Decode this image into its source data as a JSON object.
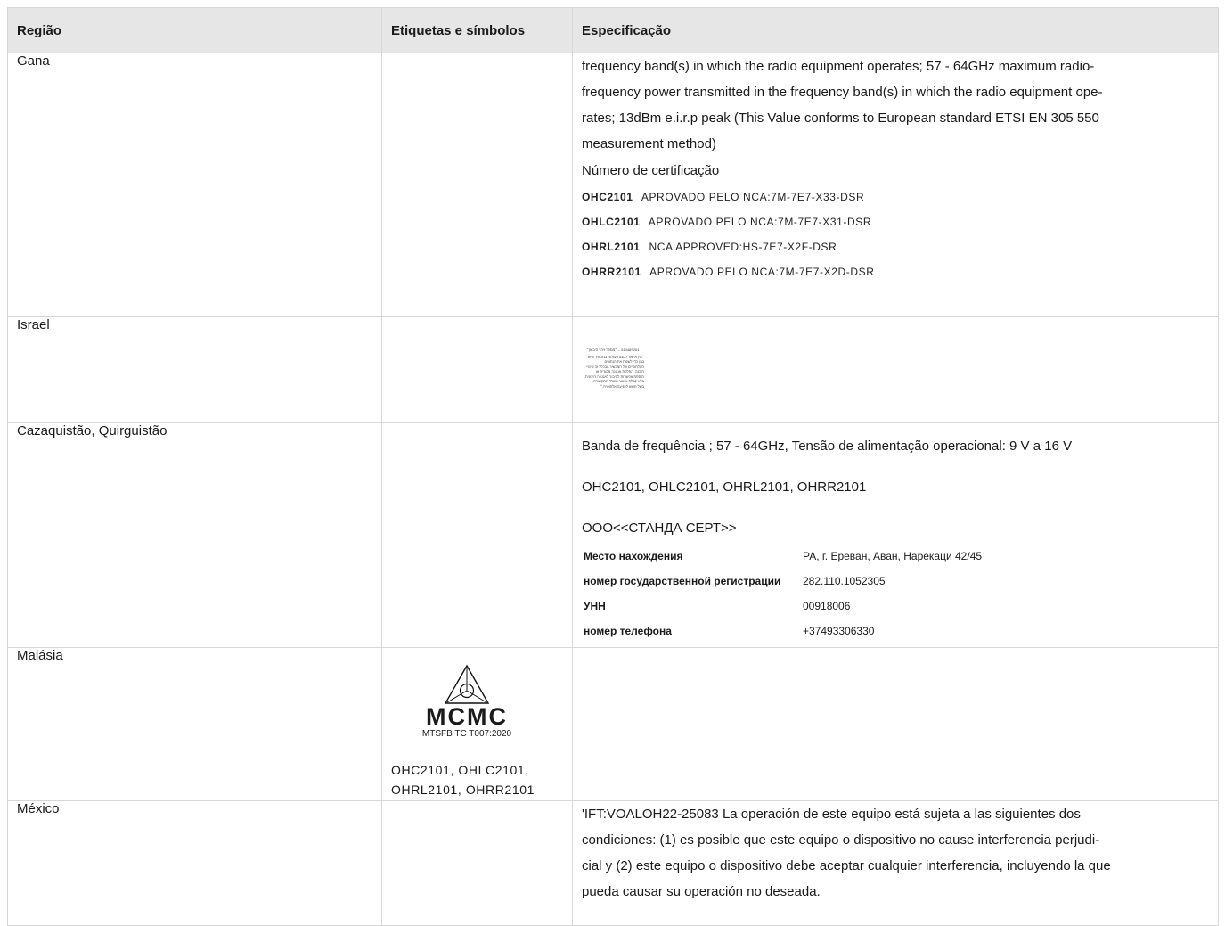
{
  "header": {
    "col_region": "Região",
    "col_labels": "Etiquetas e símbolos",
    "col_spec": "Especificação"
  },
  "ghana": {
    "region": "Gana",
    "spec_lines": [
      "frequency band(s) in which the radio equipment operates; 57 - 64GHz maximum radio-",
      "frequency power transmitted in the frequency band(s) in which the radio equipment ope-",
      "rates; 13dBm e.i.r.p peak (This Value conforms to European standard ETSI EN 305 550",
      "measurement method)"
    ],
    "cert_title": "Número de certificação",
    "certs": [
      {
        "model": "OHC2101",
        "text": "APROVADO PELO NCA:7M-7E7-X33-DSR"
      },
      {
        "model": "OHLC2101",
        "text": "APROVADO PELO NCA:7M-7E7-X31-DSR"
      },
      {
        "model": "OHRL2101",
        "text": "NCA APPROVED:HS-7E7-X2F-DSR"
      },
      {
        "model": "OHRR2101",
        "text": "APROVADO PELO NCA:7M-7E7-X2D-DSR"
      }
    ]
  },
  "israel": {
    "region": "Israel",
    "label_number": "51048S261 – ״מספר זיהוי היבואן״",
    "label_lines": [
      "״אין אישור לבצע פעולות במכשיר שיש בהן כדי לשנות את הנתונים",
      "האלחוטיים של המכשיר. ובכלל זה שינויי תוכנה, החלפת אנטנה מקורית או",
      "תוספת אפשרות לחיבור לאנטנה חיצונית. בלא קבלת אישור משרד התקשורת,",
      "בשל חשש לפגיעה אלחוטית.״"
    ]
  },
  "kz": {
    "region": "Cazaquistão, Quirguistão",
    "lines": [
      "Banda de frequência ; 57 - 64GHz, Tensão de alimentação operacional: 9 V a 16 V",
      "OHC2101, OHLC2101, OHRL2101, OHRR2101",
      "OOO<<СТАНДА СЕРТ>>"
    ],
    "address": [
      {
        "key": "Место нахождения",
        "value": "РА, г. Ереван, Аван, Нарекаци   42/45"
      },
      {
        "key": "номер государственной регистрации",
        "value": "282.110.1052305"
      },
      {
        "key": "УНН",
        "value": "00918006"
      },
      {
        "key": "номер телефона",
        "value": "+37493306330"
      }
    ]
  },
  "malaysia": {
    "region": "Malásia",
    "logo_text": "MCMC",
    "logo_sub": "MTSFB TC T007:2020",
    "models_line1": "OHC2101, OHLC2101,",
    "models_line2": "OHRL2101, OHRR2101"
  },
  "mexico": {
    "region": "México",
    "spec_lines": [
      "'IFT:VOALOH22-25083 La operación de este equipo está sujeta a las siguientes dos",
      "condiciones: (1) es posible que este equipo o dispositivo no cause interferencia perjudi-",
      "cial y (2) este equipo o dispositivo debe aceptar cualquier interferencia, incluyendo la que",
      "pueda causar su operación no deseada."
    ]
  }
}
